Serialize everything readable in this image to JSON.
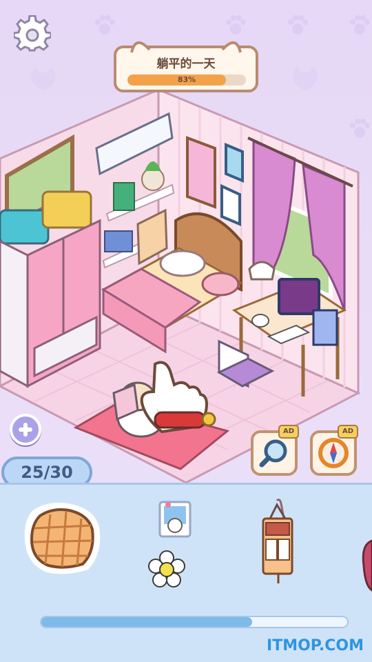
{
  "header": {
    "title": "躺平的一天",
    "progress_label": "83%",
    "progress_fraction": 0.83
  },
  "controls": {
    "settings_icon": "gear-icon",
    "add_icon": "plus-icon",
    "item_counter": "25/30",
    "search_tool": {
      "icon": "magnifier-icon",
      "badge": "AD"
    },
    "compass_tool": {
      "icon": "compass-icon",
      "badge": "AD"
    }
  },
  "tray": {
    "items": [
      "waffle-cushion-item",
      "cat-photo-sticker-item",
      "flower-sticker-item",
      "hanging-organizer-item"
    ],
    "scroll_fraction": 0.69
  },
  "watermark": "ITMOP.COM",
  "colors": {
    "background": "#e9dcf7",
    "accent_orange": "#f3a24a",
    "tray_blue": "#cfe3f8",
    "watermark_blue": "#2f95e0"
  }
}
